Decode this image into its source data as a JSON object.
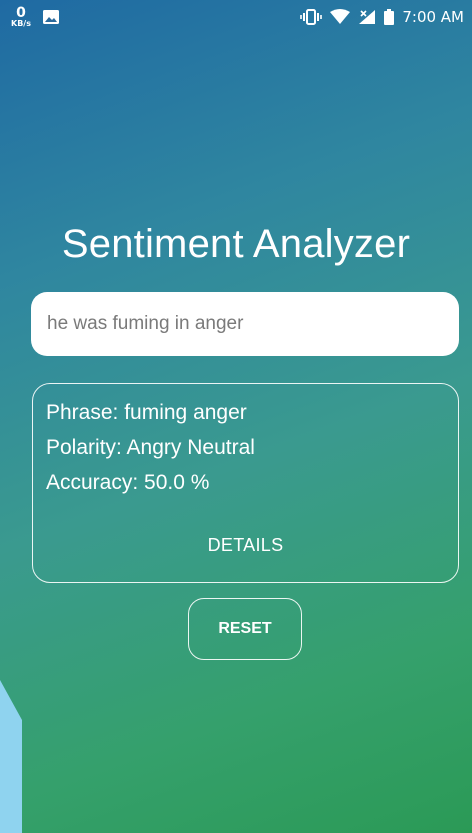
{
  "status_bar": {
    "net_speed_value": "0",
    "net_speed_unit": "KB/s",
    "icons": [
      "image-icon",
      "vibrate-icon",
      "wifi-icon",
      "signal-icon",
      "battery-icon"
    ],
    "time": "7:00 AM"
  },
  "app": {
    "title": "Sentiment Analyzer"
  },
  "input": {
    "value": "he was fuming in anger"
  },
  "result": {
    "phrase_line": "Phrase:  fuming anger",
    "polarity_line": "Polarity:  Angry Neutral",
    "accuracy_line": "Accuracy:  50.0 %",
    "details_label": "DETAILS"
  },
  "actions": {
    "reset_label": "RESET"
  },
  "colors": {
    "gradient_top": "#1f6aa3",
    "gradient_bottom": "#2b9a56",
    "decor_triangle": "#8fd3ef"
  }
}
